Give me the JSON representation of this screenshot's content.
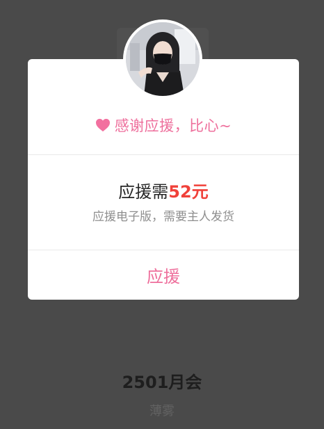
{
  "background": {
    "album_title": "2501月会",
    "author": "薄雾"
  },
  "dialog": {
    "thanks_text": "感谢应援，比心~",
    "price_prefix": "应援需",
    "price_amount": "52元",
    "description": "应援电子版，需要主人发货",
    "support_button_label": "应援"
  },
  "colors": {
    "accent_pink": "#ee6f9c",
    "price_red": "#f0413a",
    "overlay": "#4a4a4a"
  },
  "icons": {
    "heart": "heart-icon"
  }
}
